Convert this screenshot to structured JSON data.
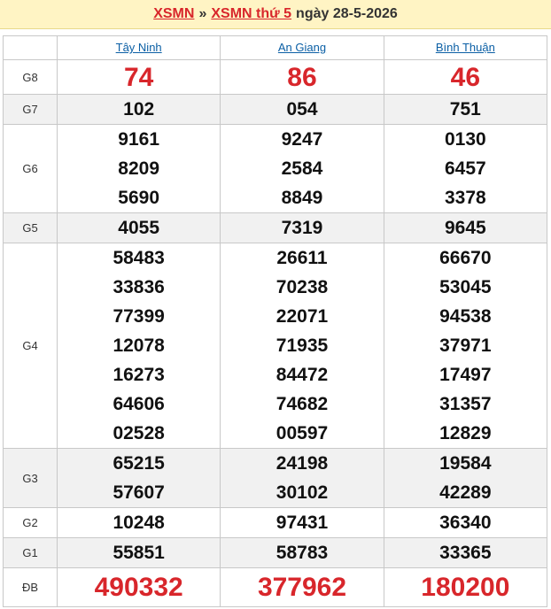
{
  "header": {
    "link1": "XSMN",
    "separator": "»",
    "link2": "XSMN thứ 5",
    "date_text": "ngày 28-5-2026"
  },
  "provinces": [
    "Tây Ninh",
    "An Giang",
    "Bình Thuận"
  ],
  "prizes": {
    "g8": {
      "label": "G8",
      "values": [
        [
          "74"
        ],
        [
          "86"
        ],
        [
          "46"
        ]
      ]
    },
    "g7": {
      "label": "G7",
      "values": [
        [
          "102"
        ],
        [
          "054"
        ],
        [
          "751"
        ]
      ]
    },
    "g6": {
      "label": "G6",
      "values": [
        [
          "9161",
          "8209",
          "5690"
        ],
        [
          "9247",
          "2584",
          "8849"
        ],
        [
          "0130",
          "6457",
          "3378"
        ]
      ]
    },
    "g5": {
      "label": "G5",
      "values": [
        [
          "4055"
        ],
        [
          "7319"
        ],
        [
          "9645"
        ]
      ]
    },
    "g4": {
      "label": "G4",
      "values": [
        [
          "58483",
          "33836",
          "77399",
          "12078",
          "16273",
          "64606",
          "02528"
        ],
        [
          "26611",
          "70238",
          "22071",
          "71935",
          "84472",
          "74682",
          "00597"
        ],
        [
          "66670",
          "53045",
          "94538",
          "37971",
          "17497",
          "31357",
          "12829"
        ]
      ]
    },
    "g3": {
      "label": "G3",
      "values": [
        [
          "65215",
          "57607"
        ],
        [
          "24198",
          "30102"
        ],
        [
          "19584",
          "42289"
        ]
      ]
    },
    "g2": {
      "label": "G2",
      "values": [
        [
          "10248"
        ],
        [
          "97431"
        ],
        [
          "36340"
        ]
      ]
    },
    "g1": {
      "label": "G1",
      "values": [
        [
          "55851"
        ],
        [
          "58783"
        ],
        [
          "33365"
        ]
      ]
    },
    "db": {
      "label": "ĐB",
      "values": [
        [
          "490332"
        ],
        [
          "377962"
        ],
        [
          "180200"
        ]
      ]
    }
  },
  "colors": {
    "accent_red": "#d8262b",
    "link_blue": "#0b5fa5",
    "header_bg": "#fff4c4"
  }
}
